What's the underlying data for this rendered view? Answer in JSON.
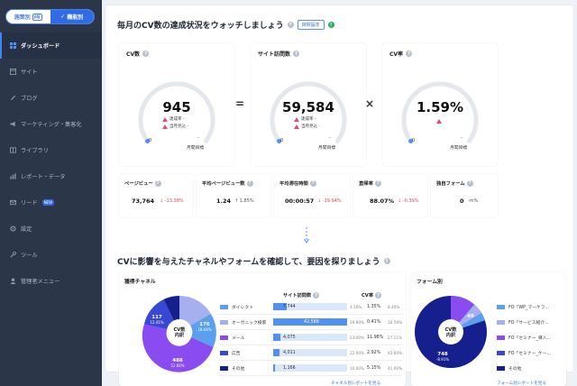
{
  "sidebar": {
    "toggle": {
      "left": "施策別",
      "left_badge": "β版",
      "right": "機能別"
    },
    "items": [
      {
        "label": "ダッシュボード",
        "icon": "dashboard-icon"
      },
      {
        "label": "サイト",
        "icon": "site-icon"
      },
      {
        "label": "ブログ",
        "icon": "pen-icon"
      },
      {
        "label": "マーケティング・集客化",
        "icon": "megaphone-icon"
      },
      {
        "label": "ライブラリ",
        "icon": "library-icon"
      },
      {
        "label": "レポート・データ",
        "icon": "chart-icon"
      },
      {
        "label": "リード",
        "icon": "mail-icon",
        "badge": "NEW"
      },
      {
        "label": "設定",
        "icon": "gear-icon"
      },
      {
        "label": "ツール",
        "icon": "wrench-icon"
      },
      {
        "label": "管理者メニュー",
        "icon": "admin-icon"
      }
    ]
  },
  "header": {
    "title": "毎月のCV数の達成状況をウォッチしましょう",
    "setting_label": "目標設定",
    "help_glyph": "?",
    "info_glyph": "!"
  },
  "kpis": {
    "cv": {
      "label": "CV数",
      "value": "945",
      "line1": "達成率 -",
      "line2": "当月見込 -",
      "axis_min": "0",
      "axis_max_top": "-",
      "axis_max": "月間目標",
      "fraction": 0.0
    },
    "operator1": "=",
    "visits": {
      "label": "サイト訪問数",
      "value": "59,584",
      "line1": "達成率 -",
      "line2": "当月見込 -",
      "axis_min": "0",
      "axis_max_top": "-",
      "axis_max": "月間目標",
      "fraction": 0.0
    },
    "operator2": "×",
    "cvr": {
      "label": "CV率",
      "value": "1.59%",
      "axis_min": "0",
      "axis_max_top": "-",
      "axis_max": "月間目標",
      "fraction": 0.0
    }
  },
  "metrics": [
    {
      "label": "ページビュー",
      "value": "73,764",
      "change": "↓ -13.38%",
      "trend": "down"
    },
    {
      "label": "平均ページビュー数",
      "value": "1.24",
      "change": "↑ 1.85%",
      "trend": "up"
    },
    {
      "label": "平均滞在時間",
      "value": "00:00:57",
      "change": "↓ -19.94%",
      "trend": "down"
    },
    {
      "label": "直帰率",
      "value": "88.07%",
      "change": "↓ -0.39%",
      "trend": "down"
    },
    {
      "label": "独自フォーム",
      "value": "0",
      "change": "-m%",
      "trend": "none"
    }
  ],
  "section2": {
    "title": "CVに影響を与えたチャネルやフォームを確認して、要因を探りましょう"
  },
  "channels": {
    "title": "獲得チャネル",
    "center": {
      "line1": "CV数",
      "line2": "内訳"
    },
    "col_visits": "サイト訪問数",
    "col_cvr": "CV率",
    "more": "チャネル別レポートを見る",
    "pie_labels": [
      {
        "value": "117",
        "pct": "12.41%"
      },
      {
        "value": "176",
        "pct": "18.64%"
      },
      {
        "value": "488",
        "pct": "51.66%"
      }
    ],
    "rows": [
      {
        "name": "ダイレクト",
        "color": "#5aa0ef",
        "visits": "7,744",
        "visit_share": "4.16%",
        "cvr": "1.35%",
        "cv_share": "8.40%",
        "fill": 0.18
      },
      {
        "name": "オーガニック検索",
        "color": "#a6b0ee",
        "visits": "42,588",
        "visit_share": "59.80%",
        "cvr": "0.41%",
        "cv_share": "30.59%",
        "fill": 1.0
      },
      {
        "name": "メール",
        "color": "#8a4bf0",
        "visits": "4,075",
        "visit_share": "23.00%",
        "cvr": "11.98%",
        "cv_share": "27.11%",
        "fill": 0.1
      },
      {
        "name": "広告",
        "color": "#3848d4",
        "visits": "4,011",
        "visit_share": "22.00%",
        "cvr": "2.92%",
        "cv_share": "45.60%",
        "fill": 0.09
      },
      {
        "name": "その他",
        "color": "#151f8e",
        "visits": "1,166",
        "visit_share": "10.00%",
        "cvr": "5.15%",
        "cv_share": "41.00%",
        "fill": 0.03
      }
    ]
  },
  "forms": {
    "title": "フォーム別",
    "center": {
      "line1": "CV数",
      "line2": "内訳"
    },
    "more": "フォーム別レポートを見る",
    "pie_labels": [
      {
        "value": "748",
        "pct": "-8.91%"
      },
      {
        "value": "49",
        "pct": ""
      }
    ],
    "rows": [
      {
        "name": "FO「WP_マーケフ...",
        "color": "#5aa0ef"
      },
      {
        "name": "FO「サービス紹介...",
        "color": "#a6b0ee"
      },
      {
        "name": "FO「セミナー_導入...",
        "color": "#8a4bf0"
      },
      {
        "name": "FO「セミナー_ケー...",
        "color": "#3848d4"
      },
      {
        "name": "その他",
        "color": "#151f8e"
      }
    ]
  },
  "colors": {
    "accent": "#2f6be3",
    "sidebar_bg": "#2c3649",
    "gauge_track": "#e4e7ec",
    "alert": "#e8457c"
  }
}
